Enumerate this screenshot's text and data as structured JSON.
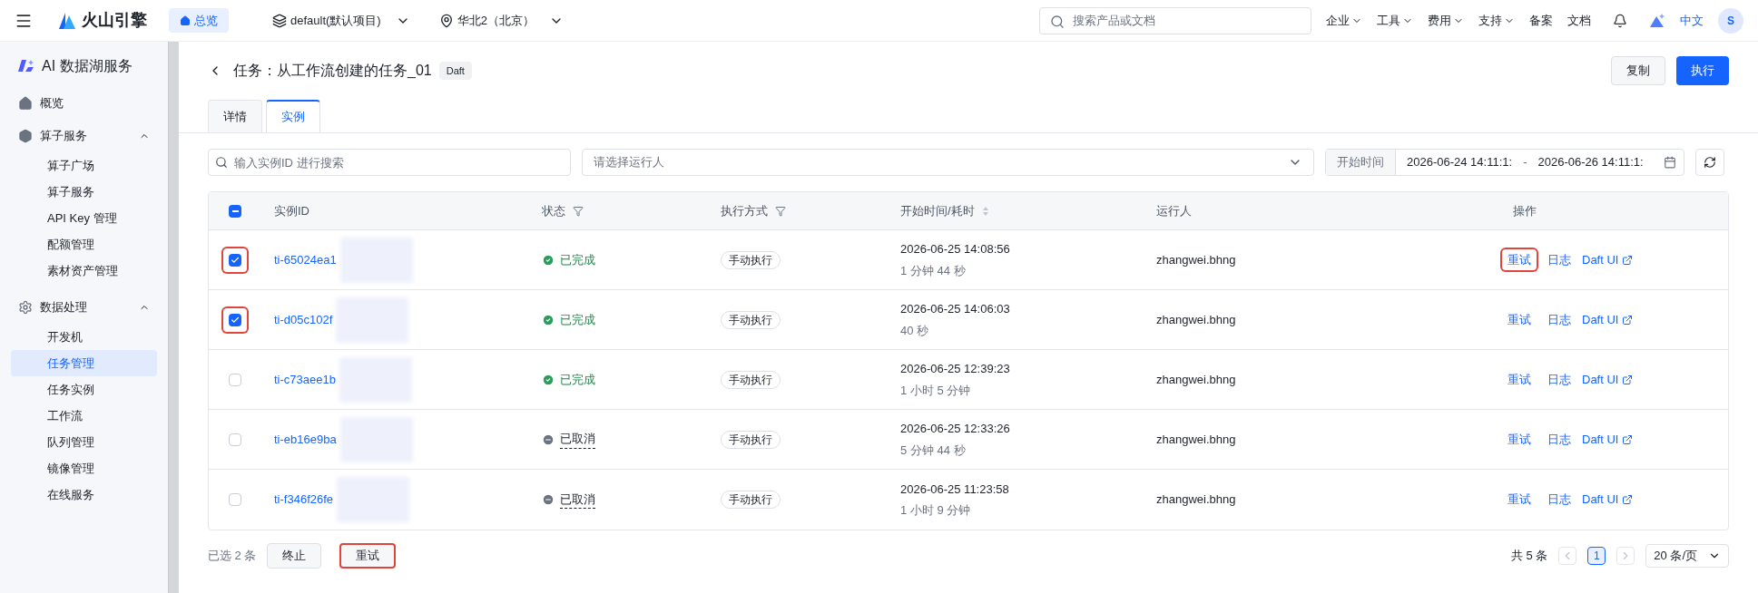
{
  "topbar": {
    "brand": "火山引擎",
    "home": "总览",
    "project": "default(默认项目)",
    "region": "华北2（北京）",
    "search": {
      "placeholder": "搜索产品或文档"
    },
    "menus": [
      {
        "label": "企业",
        "dropdown": true
      },
      {
        "label": "工具",
        "dropdown": true
      },
      {
        "label": "费用",
        "dropdown": true
      },
      {
        "label": "支持",
        "dropdown": true
      },
      {
        "label": "备案",
        "dropdown": false
      },
      {
        "label": "文档",
        "dropdown": false
      }
    ],
    "language": "中文",
    "avatar": "S"
  },
  "sidebar": {
    "title": "AI 数据湖服务",
    "groups": [
      {
        "label": "概览"
      },
      {
        "label": "算子服务",
        "expanded": true,
        "children": [
          {
            "label": "算子广场",
            "selected": false
          },
          {
            "label": "算子服务",
            "selected": false
          },
          {
            "label": "API Key 管理",
            "selected": false
          },
          {
            "label": "配额管理",
            "selected": false
          },
          {
            "label": "素材资产管理",
            "selected": false
          }
        ]
      },
      {
        "label": "数据处理",
        "expanded": true,
        "children": [
          {
            "label": "开发机",
            "selected": false
          },
          {
            "label": "任务管理",
            "selected": true
          },
          {
            "label": "任务实例",
            "selected": false
          },
          {
            "label": "工作流",
            "selected": false
          },
          {
            "label": "队列管理",
            "selected": false
          },
          {
            "label": "镜像管理",
            "selected": false
          },
          {
            "label": "在线服务",
            "selected": false
          }
        ]
      }
    ]
  },
  "page": {
    "title": "任务：从工作流创建的任务_01",
    "tag": "Daft",
    "buttons": [
      {
        "label": "复制",
        "primary": false
      },
      {
        "label": "执行",
        "primary": true
      }
    ],
    "tabs": [
      {
        "label": "详情",
        "selected": false
      },
      {
        "label": "实例",
        "selected": true
      }
    ],
    "filters": {
      "id_search": {
        "placeholder": "输入实例ID 进行搜索"
      },
      "runner_select": {
        "placeholder": "请选择运行人"
      },
      "time_label": "开始时间",
      "time_start": "2026-06-24 14:11:1:",
      "time_separator": "-",
      "time_end": "2026-06-26 14:11:1:"
    },
    "table": {
      "columns": [
        "实例ID",
        "状态",
        "执行方式",
        "开始时间/耗时",
        "运行人",
        "操作"
      ],
      "select_all": {
        "checked": true,
        "partial": true
      },
      "rows": [
        {
          "checked": true,
          "highlighted": true,
          "id": "ti-65024ea1",
          "status": "已完成",
          "kind": "done",
          "method": "手动执行",
          "start": "2026-06-25 14:08:56",
          "duration": "1 分钟 44 秒",
          "runner": "zhangwei.bhng",
          "actions": {
            "retry": "重试",
            "retry_highlighted": true,
            "log": "日志",
            "ui": "Daft UI"
          }
        },
        {
          "checked": true,
          "highlighted": true,
          "id": "ti-d05c102f",
          "status": "已完成",
          "kind": "done",
          "method": "手动执行",
          "start": "2026-06-25 14:06:03",
          "duration": "40 秒",
          "runner": "zhangwei.bhng",
          "actions": {
            "retry": "重试",
            "retry_highlighted": false,
            "log": "日志",
            "ui": "Daft UI"
          }
        },
        {
          "checked": false,
          "highlighted": false,
          "id": "ti-c73aee1b",
          "status": "已完成",
          "kind": "done",
          "method": "手动执行",
          "start": "2026-06-25 12:39:23",
          "duration": "1 小时 5 分钟",
          "runner": "zhangwei.bhng",
          "actions": {
            "retry": "重试",
            "retry_highlighted": false,
            "log": "日志",
            "ui": "Daft UI"
          }
        },
        {
          "checked": false,
          "highlighted": false,
          "id": "ti-eb16e9ba",
          "status": "已取消",
          "kind": "cancelled",
          "method": "手动执行",
          "start": "2026-06-25 12:33:26",
          "duration": "5 分钟 44 秒",
          "runner": "zhangwei.bhng",
          "actions": {
            "retry": "重试",
            "retry_highlighted": false,
            "log": "日志",
            "ui": "Daft UI"
          }
        },
        {
          "checked": false,
          "highlighted": false,
          "id": "ti-f346f26fe",
          "status": "已取消",
          "kind": "cancelled",
          "method": "手动执行",
          "start": "2026-06-25 11:23:58",
          "duration": "1 小时 9 分钟",
          "runner": "zhangwei.bhng",
          "actions": {
            "retry": "重试",
            "retry_highlighted": false,
            "log": "日志",
            "ui": "Daft UI"
          }
        }
      ]
    },
    "footer": {
      "selected_count": "已选 2 条",
      "buttons": [
        {
          "label": "终止",
          "highlighted": false
        },
        {
          "label": "重试",
          "highlighted": true
        }
      ],
      "total": "共 5 条",
      "pages": [
        {
          "label": "1",
          "selected": true
        }
      ],
      "page_size": "20 条/页"
    }
  }
}
